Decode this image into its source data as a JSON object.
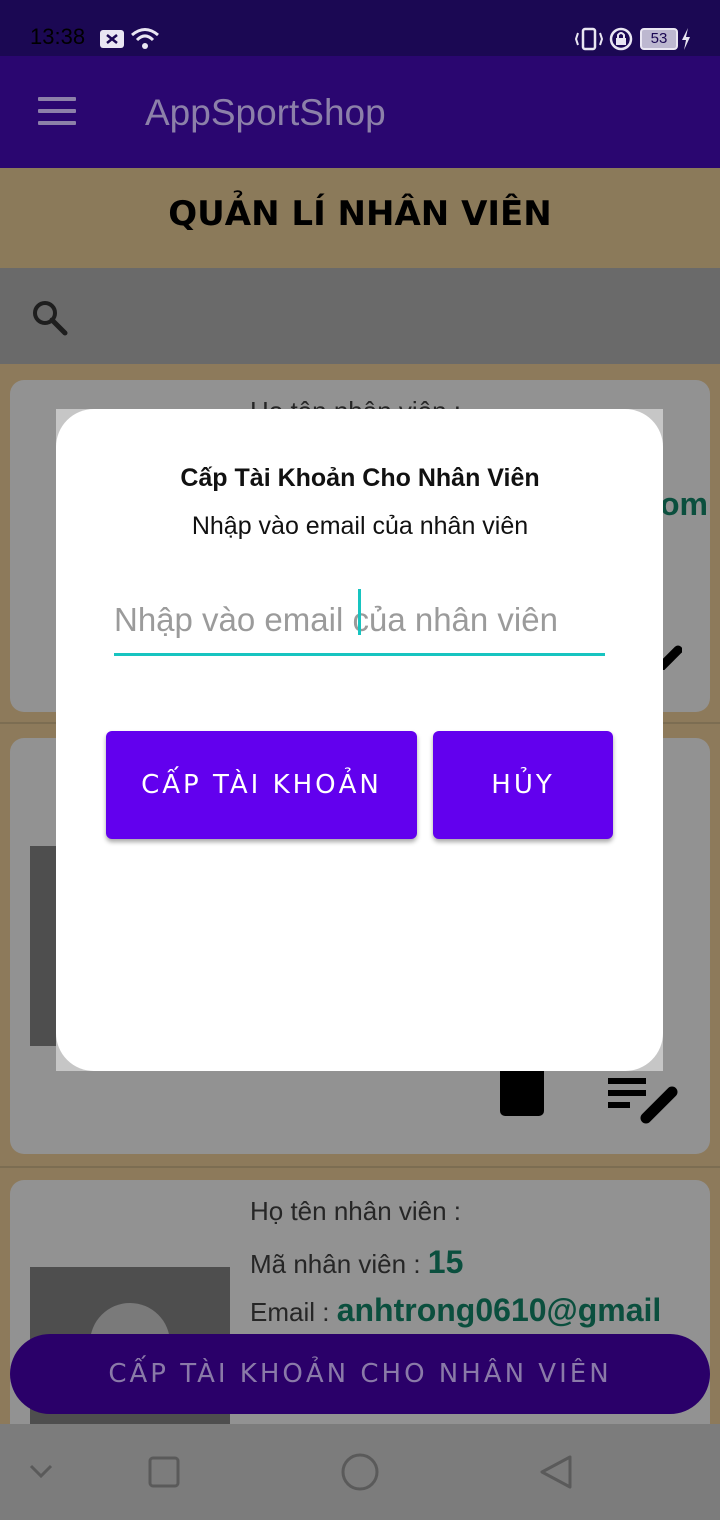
{
  "status_bar": {
    "time": "13:38",
    "battery": "53"
  },
  "app_bar": {
    "title": "AppSportShop"
  },
  "page": {
    "title": "QUẢN LÍ NHÂN VIÊN"
  },
  "cards": [
    {
      "name_label": "Họ tên nhân viên :",
      "email_tail": "om"
    },
    {},
    {
      "name_label": "Họ tên nhân viên :",
      "id_label": "Mã nhân viên :",
      "id_value": "15",
      "email_label": "Email :",
      "email_value": "anhtrong0610@gmail"
    }
  ],
  "fab": {
    "label": "CẤP TÀI KHOẢN CHO NHÂN VIÊN"
  },
  "dialog": {
    "title": "Cấp Tài Khoản Cho Nhân Viên",
    "subtitle": "Nhập vào email của nhân viên",
    "input_placeholder": "Nhập vào email của nhân viên",
    "input_value": "",
    "grant_label": "CẤP TÀI KHOẢN",
    "cancel_label": "HỦY"
  },
  "colors": {
    "primary": "#6200ee",
    "accent": "#17c4c0",
    "app_bar": "#3700b3"
  },
  "icons": [
    "menu-icon",
    "search-icon",
    "edit-icon",
    "delete-icon",
    "back-icon",
    "home-icon",
    "recents-icon"
  ]
}
